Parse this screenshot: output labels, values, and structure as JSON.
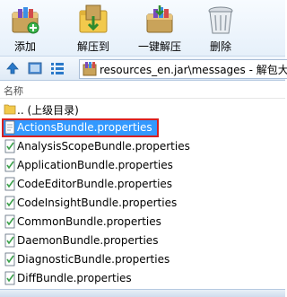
{
  "toolbar": {
    "add_label": "添加",
    "extract_to_label": "解压到",
    "one_click_extract_label": "一键解压",
    "delete_label": "删除"
  },
  "nav": {
    "address": "resources_en.jar\\messages - 解包大"
  },
  "list": {
    "column_header": "名称",
    "parent_label": ".. (上级目录)",
    "files": [
      "ActionsBundle.properties",
      "AnalysisScopeBundle.properties",
      "ApplicationBundle.properties",
      "CodeEditorBundle.properties",
      "CodeInsightBundle.properties",
      "CommonBundle.properties",
      "DaemonBundle.properties",
      "DiagnosticBundle.properties",
      "DiffBundle.properties"
    ]
  },
  "icons": {
    "add": "add-archive-icon",
    "extract_to": "extract-to-folder-icon",
    "one_click_extract": "one-click-extract-icon",
    "delete": "trash-bin-icon",
    "up": "up-arrow-icon",
    "view_large": "large-icon-view-icon",
    "view_list": "list-view-icon",
    "archive": "archive-icon",
    "folder": "folder-icon",
    "file": "properties-file-icon"
  },
  "colors": {
    "selection_fill": "#3399ff",
    "selection_outline": "#d82020",
    "toolbar_bg": "#e6f0fa"
  }
}
